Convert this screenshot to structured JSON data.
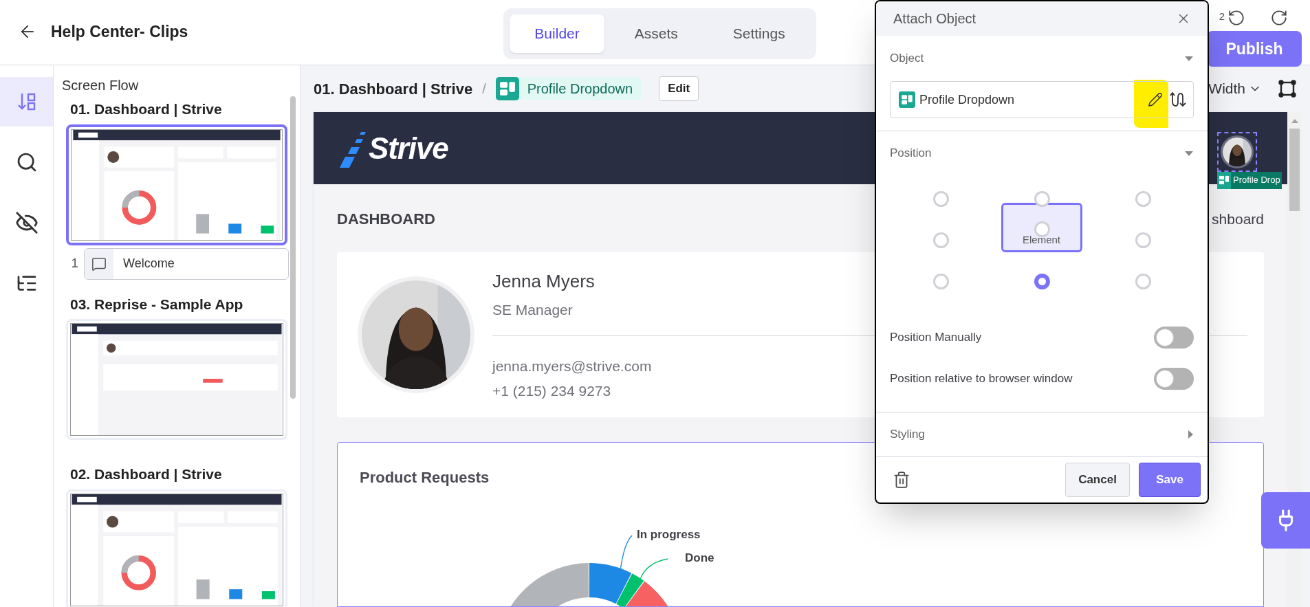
{
  "header": {
    "title": "Help Center- Clips",
    "undo_count": "2",
    "publish": "Publish"
  },
  "tabs": [
    {
      "label": "Builder",
      "selected": true
    },
    {
      "label": "Assets",
      "selected": false
    },
    {
      "label": "Settings",
      "selected": false
    }
  ],
  "rail": [
    {
      "selected": true
    },
    {
      "selected": false
    },
    {
      "selected": false
    },
    {
      "selected": false
    }
  ],
  "sidebar": {
    "title": "Screen Flow",
    "screens": [
      {
        "title": "01. Dashboard | Strive",
        "selected": true,
        "steps": [
          {
            "number": "1",
            "label": "Welcome"
          }
        ]
      },
      {
        "title": "03. Reprise - Sample App",
        "selected": false
      },
      {
        "title": "02. Dashboard | Strive",
        "selected": false
      }
    ]
  },
  "breadcrumb": {
    "screen": "01. Dashboard | Strive",
    "separator": "/",
    "object": "Profile Dropdown",
    "edit": "Edit",
    "width": "Width"
  },
  "preview": {
    "logo": "Strive",
    "avatar_tag": "Profile Drop",
    "page_title": "DASHBOARD",
    "page_title_right": "shboard",
    "profile": {
      "name": "Jenna Myers",
      "role": "SE Manager",
      "email": "jenna.myers@strive.com",
      "phone": "+1 (215) 234 9273"
    },
    "chart_card": {
      "title": "Product Requests",
      "labels": [
        {
          "text": "In progress",
          "color": "#1e88e5"
        },
        {
          "text": "Done",
          "color": "#00c16e"
        }
      ]
    }
  },
  "modal": {
    "title": "Attach Object",
    "object_label": "Object",
    "object_value": "Profile Dropdown",
    "position_label": "Position",
    "element_label": "Element",
    "position_options": [
      {
        "selected": false
      },
      {
        "selected": false
      },
      {
        "selected": false
      },
      {
        "selected": false
      },
      {
        "selected": false
      },
      {
        "selected": false
      },
      {
        "selected": false
      },
      {
        "selected": true
      },
      {
        "selected": false
      }
    ],
    "toggles": [
      {
        "label": "Position Manually",
        "on": false
      },
      {
        "label": "Position relative to browser window",
        "on": false
      }
    ],
    "styling_label": "Styling",
    "cancel": "Cancel",
    "save": "Save"
  }
}
